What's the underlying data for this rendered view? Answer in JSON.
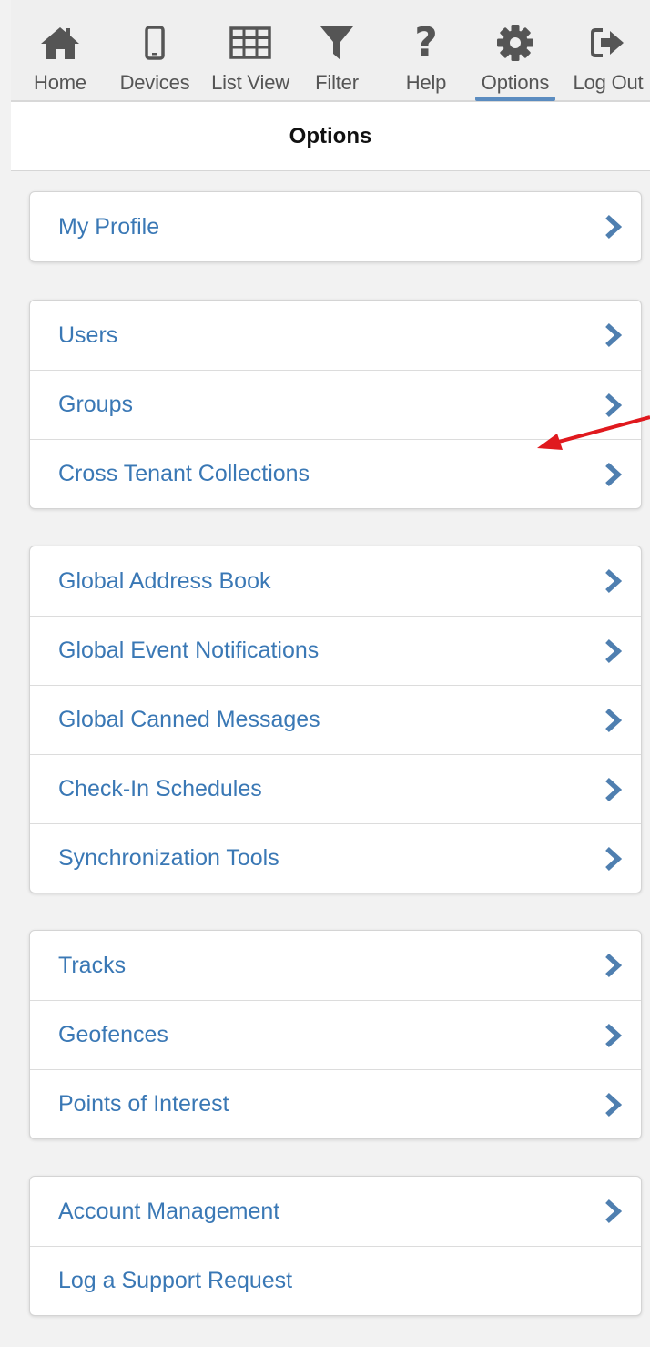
{
  "nav": {
    "items": [
      {
        "label": "Home",
        "icon": "home-icon"
      },
      {
        "label": "Devices",
        "icon": "phone-icon"
      },
      {
        "label": "List View",
        "icon": "grid-icon"
      },
      {
        "label": "Filter",
        "icon": "filter-icon"
      },
      {
        "label": "Help",
        "icon": "help-icon"
      },
      {
        "label": "Options",
        "icon": "gear-icon",
        "active": true
      },
      {
        "label": "Log Out",
        "icon": "logout-icon"
      }
    ]
  },
  "header": {
    "title": "Options"
  },
  "groups": [
    {
      "items": [
        {
          "label": "My Profile"
        }
      ]
    },
    {
      "items": [
        {
          "label": "Users"
        },
        {
          "label": "Groups"
        },
        {
          "label": "Cross Tenant Collections"
        }
      ]
    },
    {
      "items": [
        {
          "label": "Global Address Book"
        },
        {
          "label": "Global Event Notifications"
        },
        {
          "label": "Global Canned Messages"
        },
        {
          "label": "Check-In Schedules"
        },
        {
          "label": "Synchronization Tools"
        }
      ]
    },
    {
      "items": [
        {
          "label": "Tracks"
        },
        {
          "label": "Geofences"
        },
        {
          "label": "Points of Interest"
        }
      ]
    },
    {
      "items": [
        {
          "label": "Account Management"
        },
        {
          "label": "Log a Support Request"
        }
      ]
    }
  ],
  "colors": {
    "link": "#3a78b5",
    "chevron": "#4f7fb0",
    "active_underline": "#5b8cc0",
    "annotation_arrow": "#e0191e"
  }
}
